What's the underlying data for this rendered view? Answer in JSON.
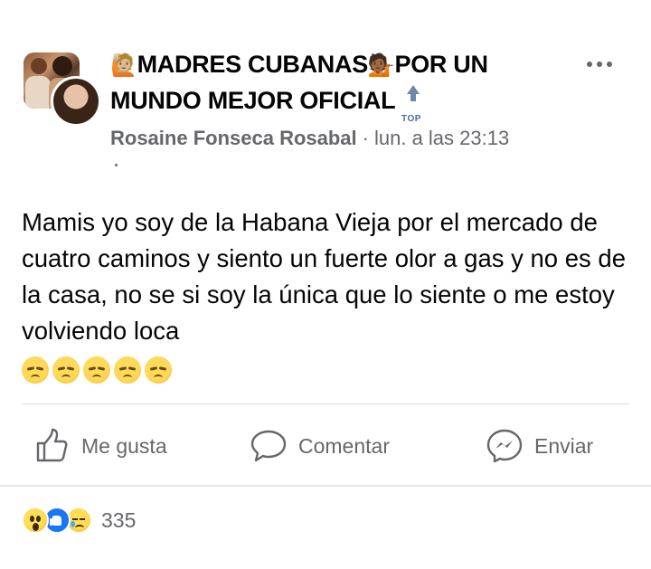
{
  "post": {
    "group_name_line1": "MADRES CUBANAS",
    "group_name_line2": "POR UN",
    "group_name_line3": "MUNDO MEJOR OFICIAL",
    "title_emoji_1": "🙋🏼",
    "title_emoji_2": "💁🏾",
    "top_badge_text": "TOP",
    "author": "Rosaine Fonseca Rosabal",
    "separator": "·",
    "timestamp": "lun. a las 23:13",
    "body": "Mamis yo soy de la Habana Vieja por el mercado de cuatro caminos y siento un fuerte olor a gas y no es de la casa, no se si soy la única que lo siente o me estoy volviendo loca",
    "body_emojis": [
      "disappointed-face",
      "disappointed-face",
      "disappointed-face",
      "disappointed-face",
      "disappointed-face"
    ]
  },
  "actions": {
    "like_label": "Me gusta",
    "comment_label": "Comentar",
    "send_label": "Enviar"
  },
  "reactions": {
    "icons": [
      "wow-icon",
      "like-icon",
      "sad-icon"
    ],
    "count": "335"
  },
  "colors": {
    "text_primary": "#050505",
    "text_secondary": "#65676b",
    "divider": "#dadde1",
    "like_blue": "#1877f2"
  }
}
